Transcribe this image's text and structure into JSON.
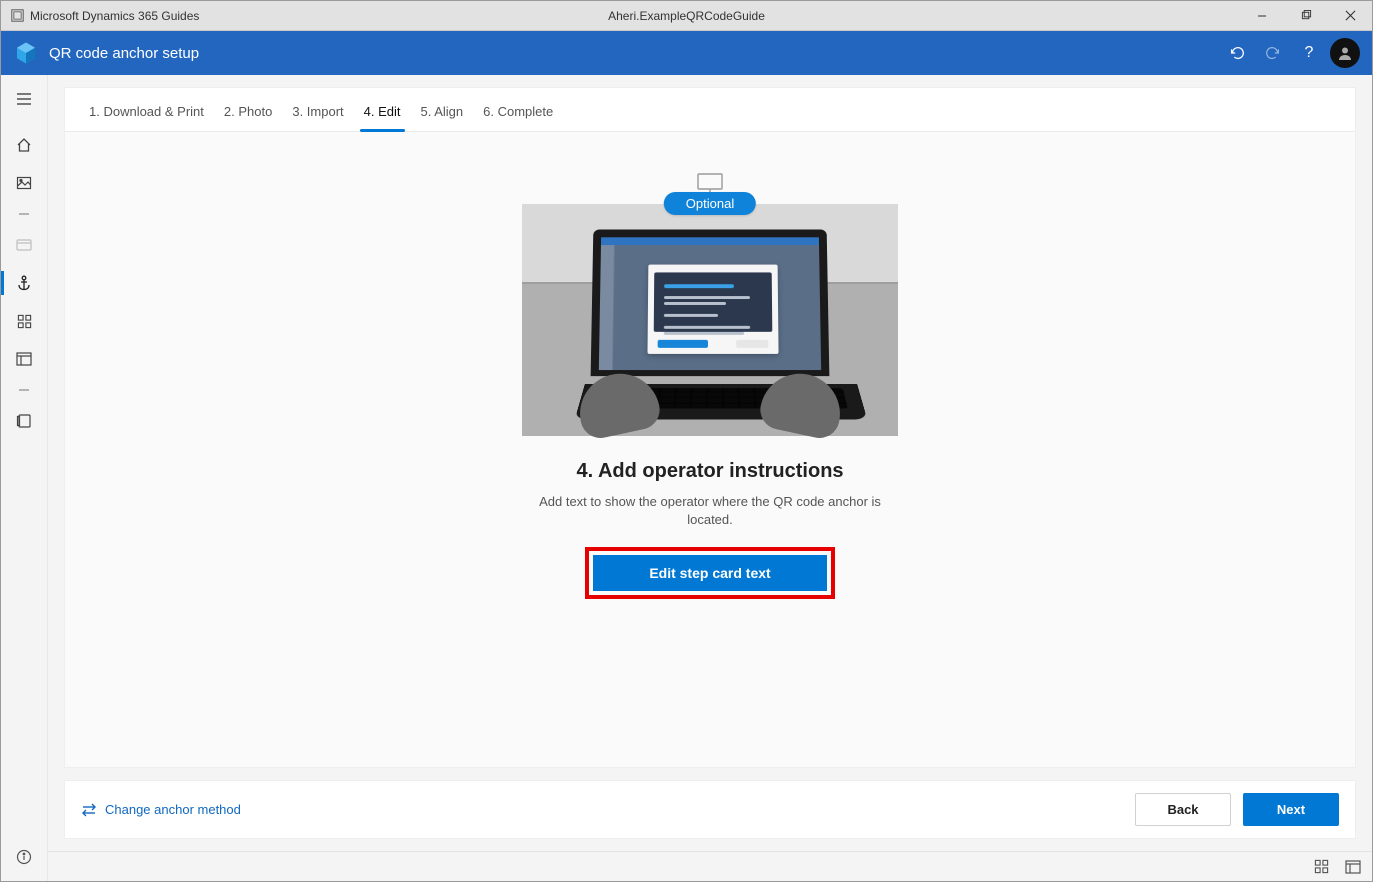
{
  "window": {
    "app_name": "Microsoft Dynamics 365 Guides",
    "document_title": "Aheri.ExampleQRCodeGuide"
  },
  "appbar": {
    "title": "QR code anchor setup"
  },
  "tabs": [
    {
      "label": "1. Download & Print"
    },
    {
      "label": "2. Photo"
    },
    {
      "label": "3. Import"
    },
    {
      "label": "4. Edit",
      "active": true
    },
    {
      "label": "5. Align"
    },
    {
      "label": "6. Complete"
    }
  ],
  "leftnav": {
    "items": [
      {
        "name": "hamburger-icon"
      },
      {
        "name": "home-icon"
      },
      {
        "name": "image-icon"
      },
      {
        "name": "collapse-icon"
      },
      {
        "name": "card-icon"
      },
      {
        "name": "anchor-icon",
        "active": true
      },
      {
        "name": "grid-icon"
      },
      {
        "name": "layout-icon"
      },
      {
        "name": "collapse2-icon"
      },
      {
        "name": "library-icon"
      }
    ]
  },
  "content": {
    "badge": "Optional",
    "title": "4. Add operator instructions",
    "description": "Add text to show the operator where the QR code anchor is located.",
    "cta_label": "Edit step card text"
  },
  "footer": {
    "change_label": "Change anchor method",
    "back_label": "Back",
    "next_label": "Next"
  }
}
